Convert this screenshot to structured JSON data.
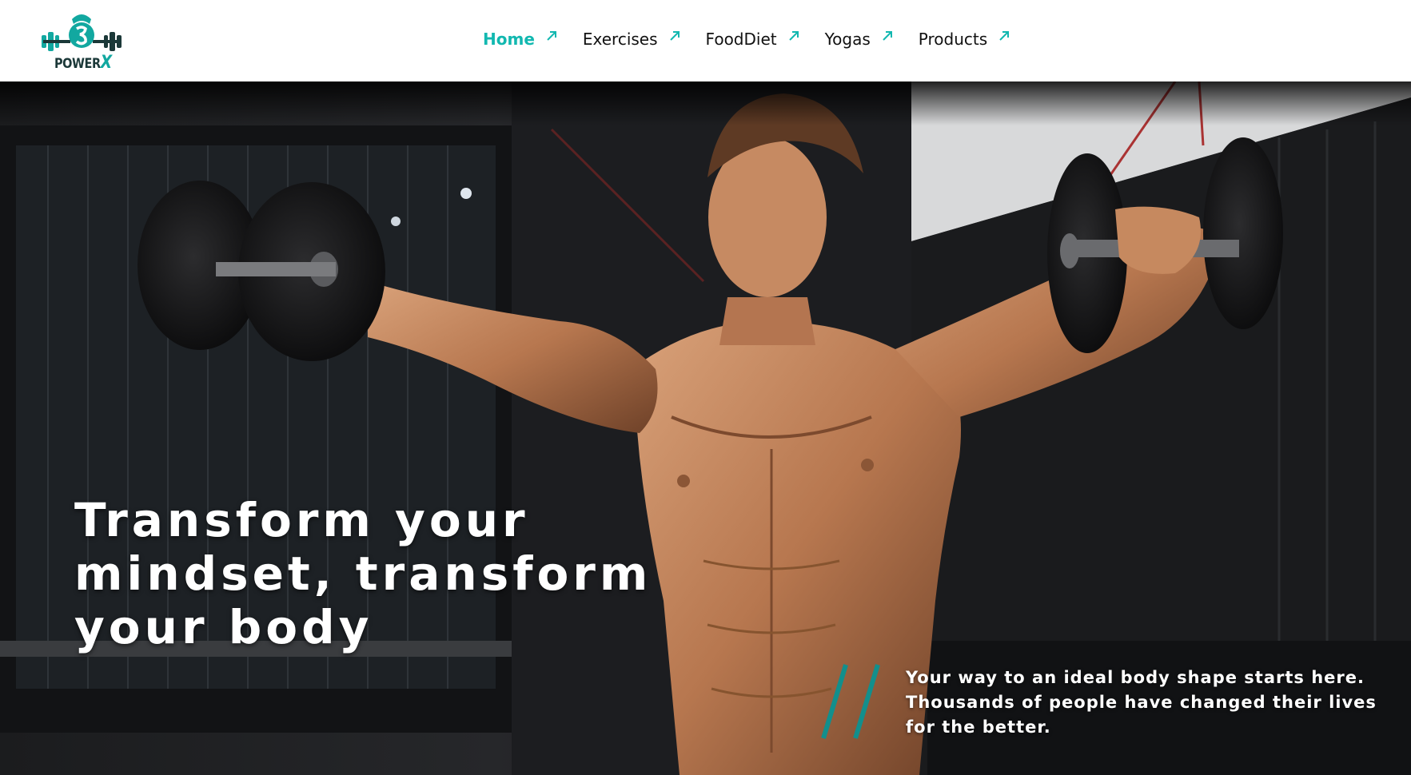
{
  "logo": {
    "brand_main": "POWER",
    "brand_accent": "X",
    "icon": "kettlebell-barbell-logo-icon"
  },
  "nav": {
    "items": [
      {
        "label": "Home",
        "active": true,
        "icon": "arrow-up-right-icon"
      },
      {
        "label": "Exercises",
        "active": false,
        "icon": "arrow-up-right-icon"
      },
      {
        "label": "FoodDiet",
        "active": false,
        "icon": "arrow-up-right-icon"
      },
      {
        "label": "Yogas",
        "active": false,
        "icon": "arrow-up-right-icon"
      },
      {
        "label": "Products",
        "active": false,
        "icon": "arrow-up-right-icon"
      }
    ]
  },
  "hero": {
    "title": "Transform your mindset, transform your body",
    "subtitle": "Your way to an ideal body shape starts here. Thousands of people have changed their lives for the better.",
    "image": "man-lifting-dumbbells-photo"
  },
  "colors": {
    "accent": "#12b8b0",
    "logo_dark": "#1b3838",
    "nav_text": "#111111",
    "hero_text": "#ffffff"
  }
}
